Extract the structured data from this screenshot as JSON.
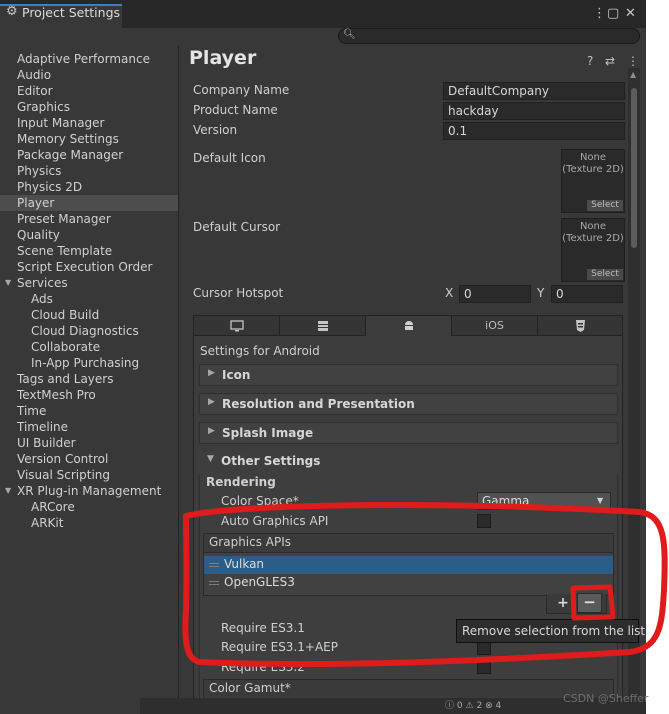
{
  "window": {
    "tab_icon": "gear-icon",
    "title": "Project Settings",
    "buttons": [
      "more-icon",
      "maximize-icon",
      "close-icon"
    ]
  },
  "search": {
    "placeholder": ""
  },
  "sidebar": {
    "items": [
      {
        "label": "Adaptive Performance"
      },
      {
        "label": "Audio"
      },
      {
        "label": "Editor"
      },
      {
        "label": "Graphics"
      },
      {
        "label": "Input Manager"
      },
      {
        "label": "Memory Settings"
      },
      {
        "label": "Package Manager"
      },
      {
        "label": "Physics"
      },
      {
        "label": "Physics 2D"
      },
      {
        "label": "Player",
        "selected": true
      },
      {
        "label": "Preset Manager"
      },
      {
        "label": "Quality"
      },
      {
        "label": "Scene Template"
      },
      {
        "label": "Script Execution Order"
      },
      {
        "label": "Services",
        "expanded": true
      },
      {
        "label": "Ads",
        "indent": 1
      },
      {
        "label": "Cloud Build",
        "indent": 1
      },
      {
        "label": "Cloud Diagnostics",
        "indent": 1
      },
      {
        "label": "Collaborate",
        "indent": 1
      },
      {
        "label": "In-App Purchasing",
        "indent": 1
      },
      {
        "label": "Tags and Layers"
      },
      {
        "label": "TextMesh Pro"
      },
      {
        "label": "Time"
      },
      {
        "label": "Timeline"
      },
      {
        "label": "UI Builder"
      },
      {
        "label": "Version Control"
      },
      {
        "label": "Visual Scripting"
      },
      {
        "label": "XR Plug-in Management",
        "expanded": true
      },
      {
        "label": "ARCore",
        "indent": 1
      },
      {
        "label": "ARKit",
        "indent": 1
      }
    ]
  },
  "player": {
    "title": "Player",
    "company_name_label": "Company Name",
    "company_name": "DefaultCompany",
    "product_name_label": "Product Name",
    "product_name": "hackday",
    "version_label": "Version",
    "version": "0.1",
    "default_icon_label": "Default Icon",
    "default_cursor_label": "Default Cursor",
    "texture_none": "None",
    "texture_type": "(Texture 2D)",
    "select_label": "Select",
    "cursor_hotspot_label": "Cursor Hotspot",
    "hotspot_x_label": "X",
    "hotspot_x": "0",
    "hotspot_y_label": "Y",
    "hotspot_y": "0"
  },
  "platform_tabs": [
    {
      "icon": "monitor-icon",
      "label": ""
    },
    {
      "icon": "server-icon",
      "label": ""
    },
    {
      "icon": "android-icon",
      "label": "",
      "active": true
    },
    {
      "icon": "",
      "label": "iOS"
    },
    {
      "icon": "html5-icon",
      "label": ""
    }
  ],
  "android": {
    "heading": "Settings for Android",
    "foldouts": [
      "Icon",
      "Resolution and Presentation",
      "Splash Image",
      "Other Settings"
    ],
    "rendering_label": "Rendering",
    "color_space_label": "Color Space*",
    "color_space": "Gamma",
    "auto_graphics_label": "Auto Graphics API",
    "graphics_apis_label": "Graphics APIs",
    "graphics_apis": [
      "Vulkan",
      "OpenGLES3"
    ],
    "require_es31": "Require ES3.1",
    "require_es31_aep": "Require ES3.1+AEP",
    "require_es32": "Require ES3.2",
    "color_gamut_label": "Color Gamut*"
  },
  "list_buttons": {
    "plus": "+",
    "minus": "−"
  },
  "tooltip": "Remove selection from the list",
  "status_counts": [
    "0",
    "2",
    "4"
  ],
  "watermark": "CSDN @Sheffer",
  "colors": {
    "selection_blue": "#2c5d87",
    "annotation_red": "#e01b1b",
    "panel_bg": "#383838"
  }
}
